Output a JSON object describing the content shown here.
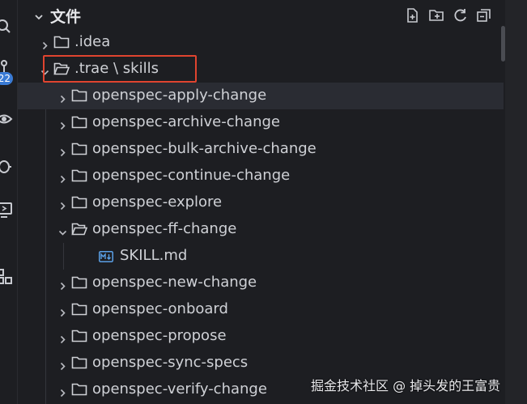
{
  "explorer": {
    "title": "文件",
    "actions": [
      {
        "name": "new-file-icon"
      },
      {
        "name": "new-folder-icon"
      },
      {
        "name": "refresh-icon"
      },
      {
        "name": "collapse-all-icon"
      }
    ]
  },
  "activity": {
    "badge": "22"
  },
  "tree": {
    "items": [
      {
        "label": ".idea",
        "level": 0,
        "expanded": false,
        "type": "folder"
      },
      {
        "label": ".trae \\ skills",
        "level": 0,
        "expanded": true,
        "type": "folder",
        "highlighted": true
      },
      {
        "label": "openspec-apply-change",
        "level": 1,
        "expanded": false,
        "type": "folder",
        "hover": true
      },
      {
        "label": "openspec-archive-change",
        "level": 1,
        "expanded": false,
        "type": "folder"
      },
      {
        "label": "openspec-bulk-archive-change",
        "level": 1,
        "expanded": false,
        "type": "folder"
      },
      {
        "label": "openspec-continue-change",
        "level": 1,
        "expanded": false,
        "type": "folder"
      },
      {
        "label": "openspec-explore",
        "level": 1,
        "expanded": false,
        "type": "folder"
      },
      {
        "label": "openspec-ff-change",
        "level": 1,
        "expanded": true,
        "type": "folder"
      },
      {
        "label": "SKILL.md",
        "level": 2,
        "type": "markdown"
      },
      {
        "label": "openspec-new-change",
        "level": 1,
        "expanded": false,
        "type": "folder"
      },
      {
        "label": "openspec-onboard",
        "level": 1,
        "expanded": false,
        "type": "folder"
      },
      {
        "label": "openspec-propose",
        "level": 1,
        "expanded": false,
        "type": "folder"
      },
      {
        "label": "openspec-sync-specs",
        "level": 1,
        "expanded": false,
        "type": "folder"
      },
      {
        "label": "openspec-verify-change",
        "level": 1,
        "expanded": false,
        "type": "folder"
      }
    ]
  },
  "watermark": "掘金技术社区 @ 掉头发的王富贵"
}
